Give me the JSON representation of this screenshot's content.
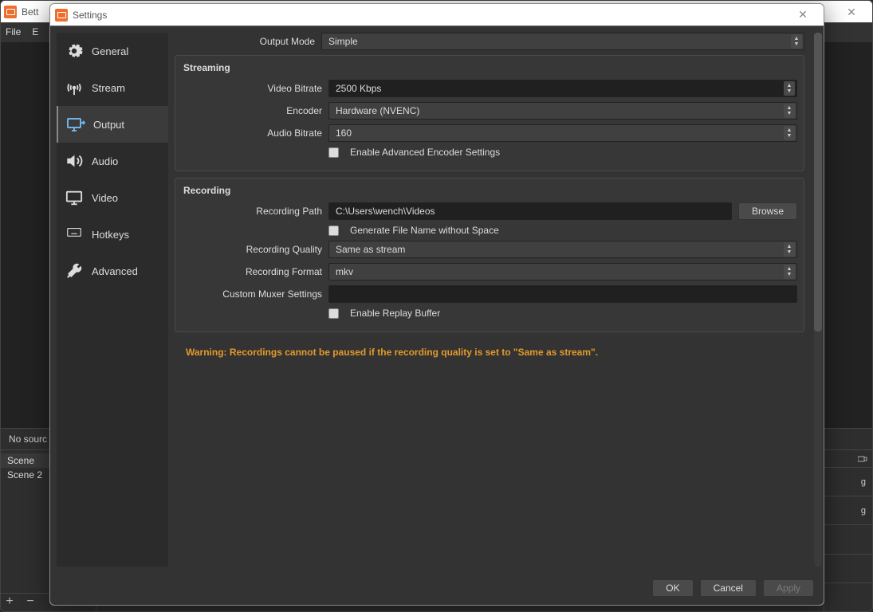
{
  "parent": {
    "title": "Bett",
    "menubar": [
      "File",
      "E"
    ],
    "no_source": "No sourc",
    "scenes": [
      "Scene",
      "Scene 2"
    ],
    "mixer_g1": "g",
    "mixer_g2": "g"
  },
  "settings": {
    "title": "Settings",
    "sidebar": [
      {
        "label": "General",
        "icon": "gear"
      },
      {
        "label": "Stream",
        "icon": "antenna"
      },
      {
        "label": "Output",
        "icon": "output",
        "active": true
      },
      {
        "label": "Audio",
        "icon": "speaker"
      },
      {
        "label": "Video",
        "icon": "monitor"
      },
      {
        "label": "Hotkeys",
        "icon": "keyboard"
      },
      {
        "label": "Advanced",
        "icon": "wrench"
      }
    ],
    "output_mode": {
      "label": "Output Mode",
      "value": "Simple"
    },
    "streaming": {
      "title": "Streaming",
      "video_bitrate": {
        "label": "Video Bitrate",
        "value": "2500 Kbps"
      },
      "encoder": {
        "label": "Encoder",
        "value": "Hardware (NVENC)"
      },
      "audio_bitrate": {
        "label": "Audio Bitrate",
        "value": "160"
      },
      "advanced_cb": "Enable Advanced Encoder Settings"
    },
    "recording": {
      "title": "Recording",
      "path": {
        "label": "Recording Path",
        "value": "C:\\Users\\wench\\Videos"
      },
      "browse": "Browse",
      "nospace_cb": "Generate File Name without Space",
      "quality": {
        "label": "Recording Quality",
        "value": "Same as stream"
      },
      "format": {
        "label": "Recording Format",
        "value": "mkv"
      },
      "muxer": {
        "label": "Custom Muxer Settings",
        "value": ""
      },
      "replay_cb": "Enable Replay Buffer"
    },
    "warning": "Warning: Recordings cannot be paused if the recording quality is set to \"Same as stream\".",
    "buttons": {
      "ok": "OK",
      "cancel": "Cancel",
      "apply": "Apply"
    }
  }
}
